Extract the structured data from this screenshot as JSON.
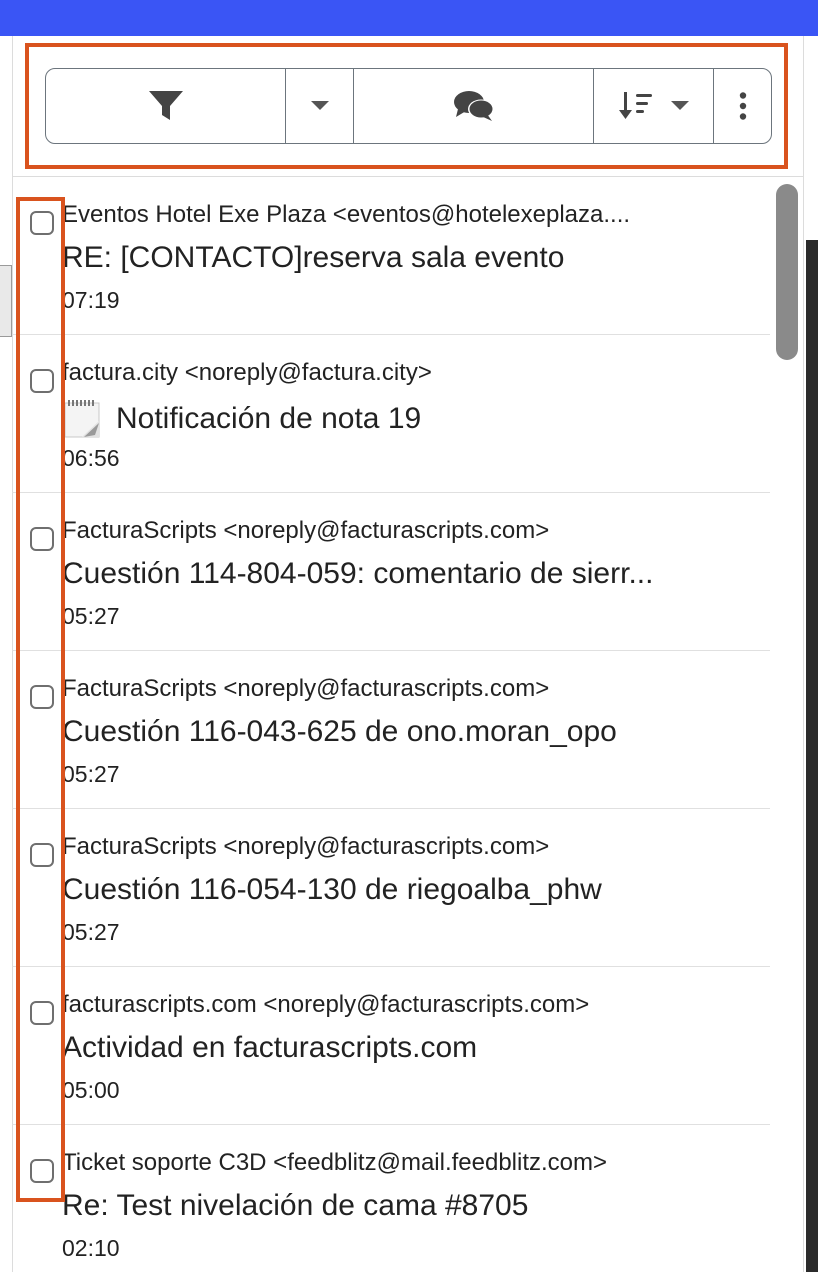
{
  "toolbar": {
    "filter_icon": "filter-icon",
    "filter_dropdown_icon": "caret-down-icon",
    "chat_icon": "comments-icon",
    "sort_icon": "sort-amount-down-icon",
    "more_icon": "ellipsis-vertical-icon"
  },
  "messages": [
    {
      "from": "Eventos Hotel Exe Plaza <eventos@hotelexeplaza....",
      "subject": "RE: [CONTACTO]reserva sala evento",
      "time": "07:19"
    },
    {
      "from": "factura.city <noreply@factura.city>",
      "subject": "Notificación de nota 19",
      "time": "06:56",
      "icon": "notepad-icon"
    },
    {
      "from": "FacturaScripts <noreply@facturascripts.com>",
      "subject": "Cuestión 114-804-059: comentario de sierr...",
      "time": "05:27"
    },
    {
      "from": "FacturaScripts <noreply@facturascripts.com>",
      "subject": "Cuestión 116-043-625 de ono.moran_opo",
      "time": "05:27"
    },
    {
      "from": "FacturaScripts <noreply@facturascripts.com>",
      "subject": "Cuestión 116-054-130 de riegoalba_phw",
      "time": "05:27"
    },
    {
      "from": "facturascripts.com <noreply@facturascripts.com>",
      "subject": "Actividad en facturascripts.com",
      "time": "05:00"
    },
    {
      "from": "Ticket soporte C3D <feedblitz@mail.feedblitz.com>",
      "subject": "Re: Test nivelación de cama #8705",
      "time": "02:10"
    }
  ],
  "colors": {
    "topbar": "#3a55f5",
    "highlight": "#d9531e",
    "button_border": "#6c757d"
  }
}
